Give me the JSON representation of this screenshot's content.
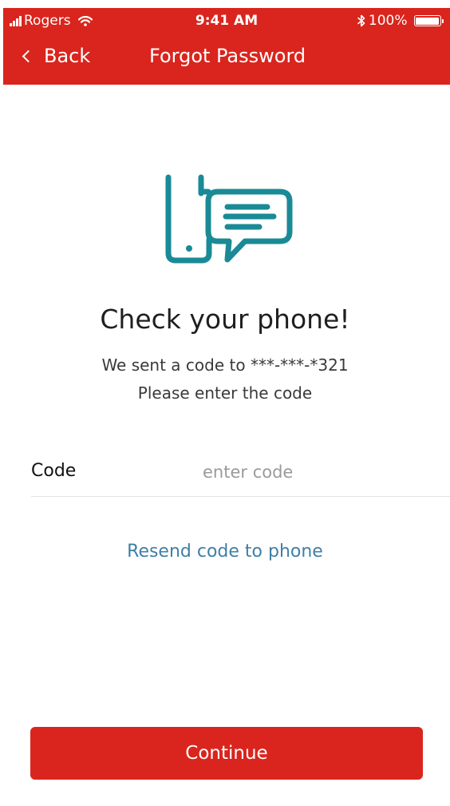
{
  "status_bar": {
    "carrier": "Rogers",
    "time": "9:41 AM",
    "battery": "100%"
  },
  "nav": {
    "back_label": "Back",
    "title": "Forgot Password"
  },
  "hero": {
    "icon": "phone-chat-icon",
    "icon_color": "#1a8a96"
  },
  "content": {
    "heading": "Check your phone!",
    "line1": "We sent a code to ***-***-*321",
    "line2": "Please enter the code"
  },
  "form": {
    "code_label": "Code",
    "code_value": "",
    "code_placeholder": "enter code"
  },
  "resend_label": "Resend code to phone",
  "continue_label": "Continue",
  "colors": {
    "brand_red": "#d9251d",
    "link_blue": "#3f7fa6",
    "icon_teal": "#1a8a96"
  }
}
